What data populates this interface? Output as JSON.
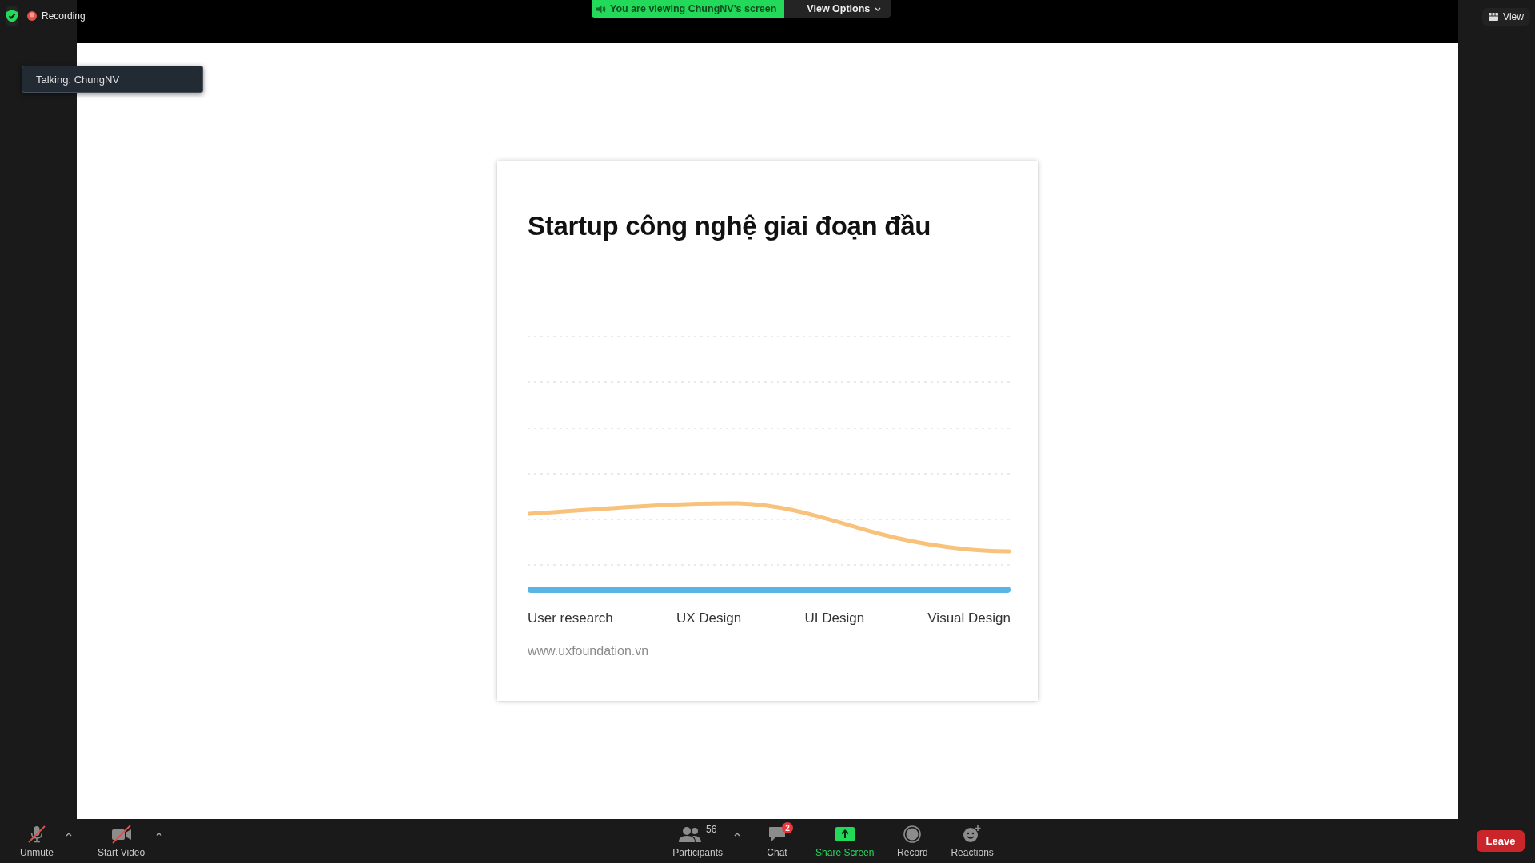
{
  "top_bar": {
    "recording": {
      "label": "Recording"
    },
    "share_banner": "You are viewing ChungNV's screen",
    "view_options": "View Options",
    "view_button": "View"
  },
  "talking_tooltip": "Talking: ChungNV",
  "slide": {
    "title": "Startup công nghệ giai đoạn đầu",
    "categories": [
      "User research",
      "UX Design",
      "UI Design",
      "Visual Design"
    ],
    "footer": "www.uxfoundation.vn"
  },
  "toolbar": {
    "left": [
      {
        "kind": "mic",
        "label": "Unmute",
        "off": true,
        "menu": true
      },
      {
        "kind": "video",
        "label": "Start Video",
        "off": true,
        "menu": true
      }
    ],
    "center": [
      {
        "kind": "participants",
        "label": "Participants",
        "count": "56",
        "menu": true
      },
      {
        "kind": "chat",
        "label": "Chat",
        "badge": "2",
        "menu": false
      },
      {
        "kind": "share",
        "label": "Share Screen",
        "menu": false
      },
      {
        "kind": "record",
        "label": "Record",
        "menu": false
      },
      {
        "kind": "reactions",
        "label": "Reactions",
        "menu": false
      }
    ],
    "leave": "Leave"
  }
}
